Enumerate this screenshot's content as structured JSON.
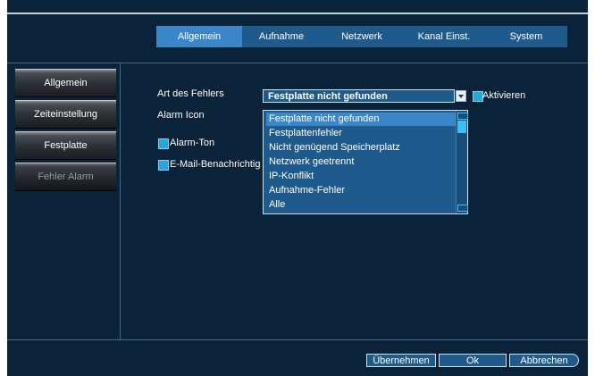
{
  "tabs": [
    {
      "label": "Allgemein",
      "active": true
    },
    {
      "label": "Aufnahme",
      "active": false
    },
    {
      "label": "Netzwerk",
      "active": false
    },
    {
      "label": "Kanal Einst.",
      "active": false
    },
    {
      "label": "System",
      "active": false
    }
  ],
  "sidebar": {
    "items": [
      {
        "label": "Allgemein"
      },
      {
        "label": "Zeiteinstellung"
      },
      {
        "label": "Festplatte"
      },
      {
        "label": "Fehler Alarm"
      }
    ]
  },
  "form": {
    "error_type_label": "Art des Fehlers",
    "error_type_value": "Festplatte nicht gefunden",
    "activate_label": "Aktivieren",
    "alarm_icon_label": "Alarm Icon",
    "alarm_tone_label": "Alarm-Ton",
    "email_label": "E-Mail-Benachrichtig"
  },
  "dropdown": {
    "options": [
      "Festplatte nicht gefunden",
      "Festplattenfehler",
      "Nicht genügend Speicherplatz",
      "Netzwerk geetrennt",
      "IP-Konflikt",
      "Aufnahme-Fehler",
      "Alle"
    ]
  },
  "buttons": {
    "apply": "Übernehmen",
    "ok": "Ok",
    "cancel": "Abbrechen"
  },
  "colors": {
    "background": "#0b2338",
    "accent": "#3a86c8",
    "panel": "#1f5a8c",
    "checkbox": "#2aa6d8"
  }
}
